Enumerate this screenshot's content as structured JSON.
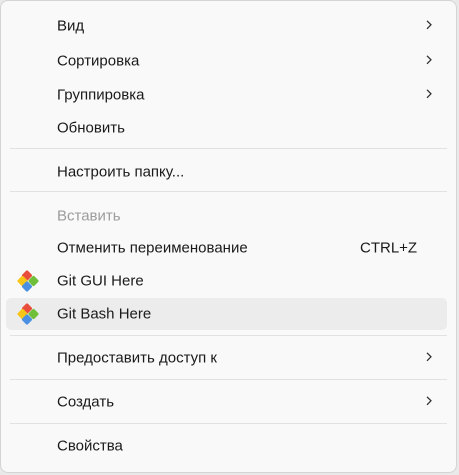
{
  "menu": {
    "items": [
      {
        "label": "Вид"
      },
      {
        "label": "Сортировка"
      },
      {
        "label": "Группировка"
      },
      {
        "label": "Обновить"
      },
      {
        "label": "Настроить папку..."
      },
      {
        "label": "Вставить",
        "disabled": true
      },
      {
        "label": "Отменить переименование",
        "shortcut": "CTRL+Z"
      },
      {
        "label": "Git GUI Here",
        "icon": "git-icon"
      },
      {
        "label": "Git Bash Here",
        "icon": "git-icon",
        "hovered": true
      },
      {
        "label": "Предоставить доступ к"
      },
      {
        "label": "Создать"
      },
      {
        "label": "Свойства"
      }
    ]
  },
  "colors": {
    "menu_background": "#f9f9f9",
    "hover_background": "#ececec",
    "disabled_text": "#9c9c9c",
    "separator": "#e2e2e2",
    "git_red": "#e94e3c",
    "git_green": "#6fbf3a",
    "git_yellow": "#f5c518",
    "git_blue": "#4a90e2"
  }
}
